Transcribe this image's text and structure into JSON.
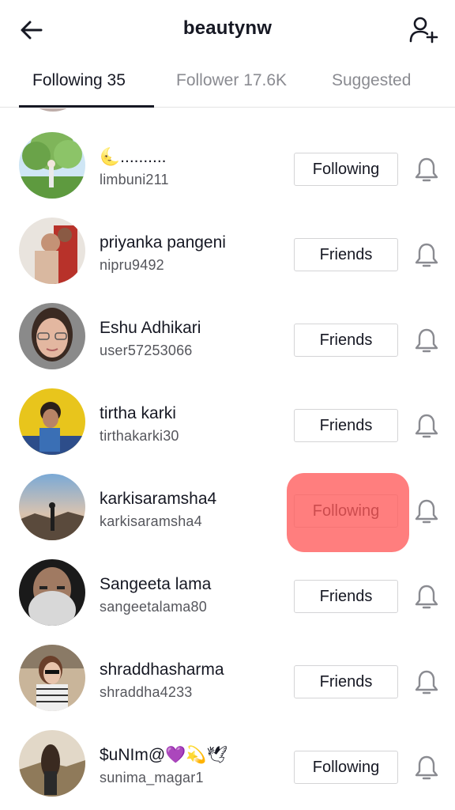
{
  "header": {
    "title": "beautynw",
    "back_icon": "arrow-left-icon",
    "add_icon": "person-plus-icon"
  },
  "tabs": [
    {
      "label": "Following 35",
      "active": true
    },
    {
      "label": "Follower 17.6K",
      "active": false
    },
    {
      "label": "Suggested",
      "active": false
    }
  ],
  "users": [
    {
      "name": "🌜..........",
      "username": "limbuni211",
      "button": "Following"
    },
    {
      "name": "priyanka pangeni",
      "username": "nipru9492",
      "button": "Friends"
    },
    {
      "name": "Eshu Adhikari",
      "username": "user57253066",
      "button": "Friends"
    },
    {
      "name": "tirtha karki",
      "username": "tirthakarki30",
      "button": "Friends"
    },
    {
      "name": "karkisaramsha4",
      "username": "karkisaramsha4",
      "button": "Following"
    },
    {
      "name": "Sangeeta lama",
      "username": "sangeetalama80",
      "button": "Friends"
    },
    {
      "name": "shraddhasharma",
      "username": "shraddha4233",
      "button": "Friends"
    },
    {
      "name": "$uNIm@💜💫🕊",
      "username": "sunima_magar1",
      "button": "Following"
    }
  ],
  "colors": {
    "text_primary": "#161823",
    "text_secondary": "#8a8b91",
    "highlight": "#ff5a5a"
  }
}
